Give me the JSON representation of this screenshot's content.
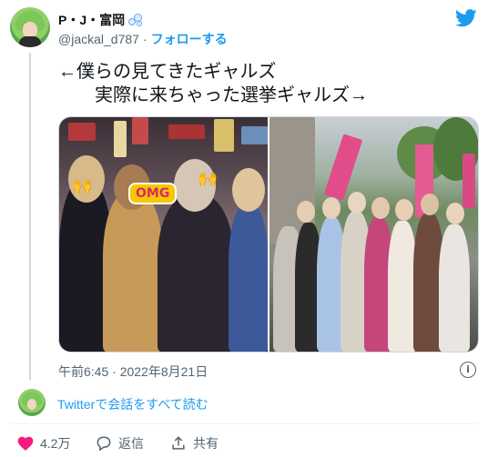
{
  "author": {
    "display_name": "P・J・富岡",
    "handle": "@jackal_d787",
    "separator": "·",
    "follow_label": "フォローする"
  },
  "tweet": {
    "line1": "←僕らの見てきたギャルズ",
    "line2": "実際に来ちゃった選挙ギャルズ→",
    "timestamp": "午前6:45 · 2022年8月21日"
  },
  "media": {
    "photo1_sticker": "OMG"
  },
  "conversation": {
    "link_label": "Twitterで会話をすべて読む"
  },
  "actions": {
    "like_count": "4.2万",
    "reply_label": "返信",
    "share_label": "共有"
  },
  "icons": {
    "brand": "twitter-bird-icon",
    "info": "info-icon",
    "like": "heart-icon",
    "reply": "speech-bubble-icon",
    "share": "share-upload-icon"
  },
  "colors": {
    "accent": "#1d9bf0",
    "text": "#0f1419",
    "muted": "#536471",
    "like": "#f91880"
  }
}
